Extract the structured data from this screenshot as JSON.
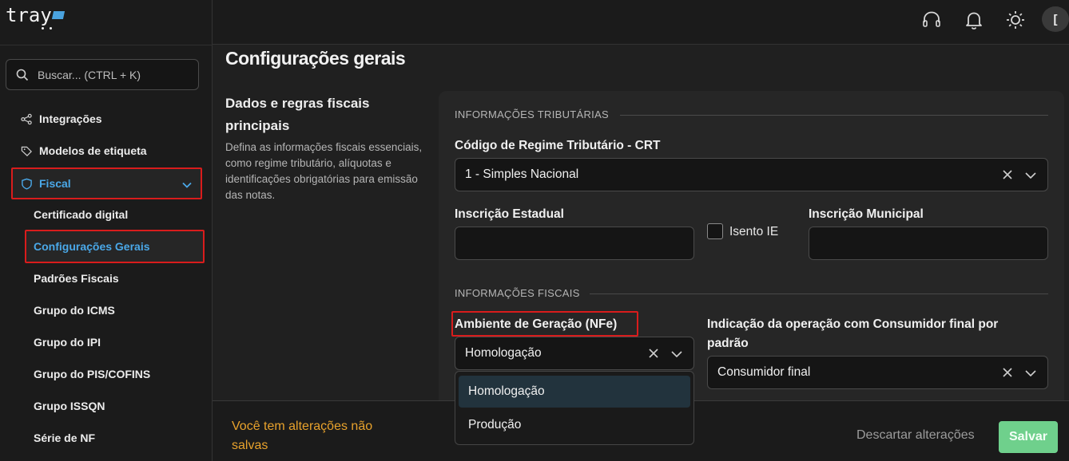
{
  "brand": {
    "logo_text": "tray",
    "accent": "#4aa3df"
  },
  "search": {
    "placeholder": "Buscar... (CTRL + K)"
  },
  "sidebar": {
    "items": [
      {
        "label": "Integrações",
        "icon": "share-icon"
      },
      {
        "label": "Modelos de etiqueta",
        "icon": "tag-icon"
      },
      {
        "label": "Fiscal",
        "icon": "shield-icon",
        "expanded": true
      }
    ],
    "fiscal_subitems": [
      {
        "label": "Certificado digital"
      },
      {
        "label": "Configurações Gerais",
        "active": true
      },
      {
        "label": "Padrões Fiscais"
      },
      {
        "label": "Grupo do ICMS"
      },
      {
        "label": "Grupo do IPI"
      },
      {
        "label": "Grupo do PIS/COFINS"
      },
      {
        "label": "Grupo ISSQN"
      },
      {
        "label": "Série de NF"
      }
    ]
  },
  "topbar": {
    "icons": [
      "headset-icon",
      "bell-icon",
      "sun-icon"
    ],
    "avatar_initial": "["
  },
  "page": {
    "title": "Configurações gerais",
    "section_title": "Dados e regras fiscais principais",
    "section_desc": "Defina as informações fiscais essenciais, como regime tributário, alíquotas e identificações obrigatórias para emissão das notas."
  },
  "form": {
    "tributarias_label": "INFORMAÇÕES TRIBUTÁRIAS",
    "crt_label": "Código de Regime Tributário - CRT",
    "crt_value": "1 - Simples Nacional",
    "ie_label": "Inscrição Estadual",
    "ie_value": "",
    "isento_label": "Isento IE",
    "isento_checked": false,
    "im_label": "Inscrição Municipal",
    "im_value": "",
    "fiscais_label": "INFORMAÇÕES FISCAIS",
    "ambiente_label": "Ambiente de Geração (NFe)",
    "ambiente_value": "Homologação",
    "ambiente_options": [
      "Homologação",
      "Produção"
    ],
    "consumidor_label": "Indicação da operação com Consumidor final por padrão",
    "consumidor_value": "Consumidor final"
  },
  "footer": {
    "unsaved_text": "Você tem alterações não salvas",
    "discard_label": "Descartar alterações",
    "save_label": "Salvar",
    "save_color": "#6fd08c",
    "warning_color": "#e8a22c"
  }
}
